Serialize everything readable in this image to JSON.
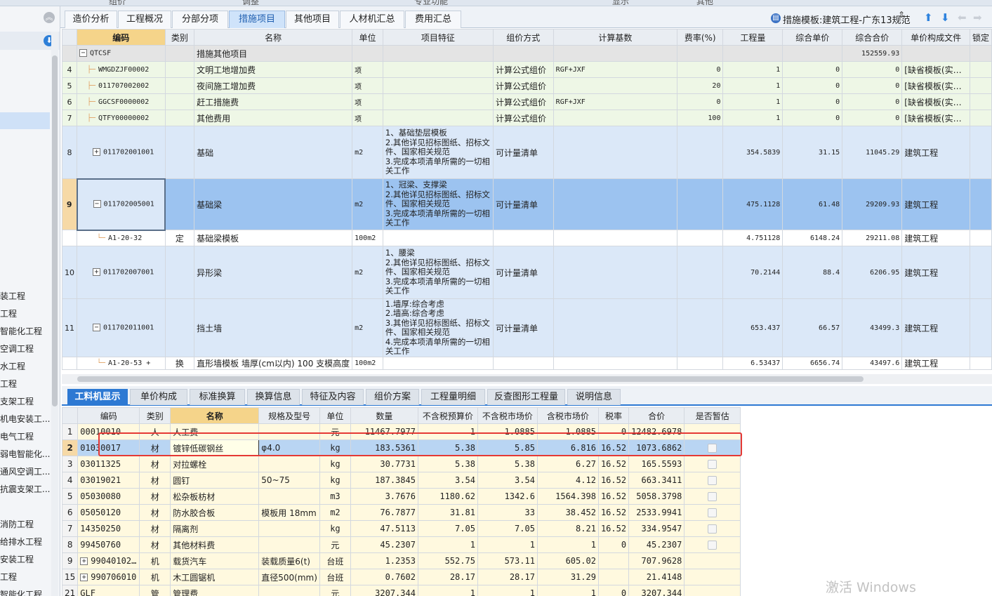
{
  "top_strip": [
    "组价",
    "调整",
    "专业功能",
    "显示",
    "其他"
  ],
  "sidebar": {
    "collapse_icon": "double-chevron-up-icon",
    "down_icon": "arrow-down-circle-icon",
    "items": [
      "装工程",
      "工程",
      "智能化工程",
      "空调工程",
      "水工程",
      "工程",
      "支架工程",
      "机电安装工...",
      "电气工程",
      "弱电智能化...",
      "通风空调工...",
      "抗震支架工...",
      "",
      "消防工程",
      "给排水工程",
      "安装工程",
      "工程",
      "智能化工程"
    ]
  },
  "tabs": [
    "造价分析",
    "工程概况",
    "分部分项",
    "措施项目",
    "其他项目",
    "人材机汇总",
    "费用汇总"
  ],
  "template": {
    "icon": "template-icon",
    "label": "措施模板:建筑工程-广东13规范",
    "spin": "⇕",
    "up": "⬆",
    "down": "⬇",
    "left": "⬅",
    "right": "➡"
  },
  "main_headers": [
    "编码",
    "类别",
    "名称",
    "单位",
    "项目特征",
    "组价方式",
    "计算基数",
    "费率(%)",
    "工程量",
    "综合单价",
    "综合合价",
    "单价构成文件",
    "锁定"
  ],
  "main_rows": [
    {
      "rn": "",
      "code": "QTCSF",
      "cat": "",
      "name": "措施其他项目",
      "unit": "",
      "feat": "",
      "method": "",
      "base": "",
      "rate": "",
      "qty": "",
      "price": "",
      "total": "152559.93",
      "file": ""
    },
    {
      "rn": "4",
      "code": "WMGDZJF00002",
      "cat": "",
      "name": "文明工地增加费",
      "unit": "项",
      "feat": "",
      "method": "计算公式组价",
      "base": "RGF+JXF",
      "rate": "0",
      "qty": "1",
      "price": "0",
      "total": "0",
      "file": "[缺省模板(实…"
    },
    {
      "rn": "5",
      "code": "011707002002",
      "cat": "",
      "name": "夜间施工增加费",
      "unit": "项",
      "feat": "",
      "method": "计算公式组价",
      "base": "",
      "rate": "20",
      "qty": "1",
      "price": "0",
      "total": "0",
      "file": "[缺省模板(实…"
    },
    {
      "rn": "6",
      "code": "GGCSF0000002",
      "cat": "",
      "name": "赶工措施费",
      "unit": "项",
      "feat": "",
      "method": "计算公式组价",
      "base": "RGF+JXF",
      "rate": "0",
      "qty": "1",
      "price": "0",
      "total": "0",
      "file": "[缺省模板(实…"
    },
    {
      "rn": "7",
      "code": "QTFY00000002",
      "cat": "",
      "name": "其他费用",
      "unit": "项",
      "feat": "",
      "method": "计算公式组价",
      "base": "",
      "rate": "100",
      "qty": "1",
      "price": "0",
      "total": "0",
      "file": "[缺省模板(实…"
    },
    {
      "rn": "8",
      "code": "011702001001",
      "cat": "",
      "name": "基础",
      "unit": "m2",
      "feat": "1、基础垫层模板\n2.其他详见招标图纸、招标文件、国家相关规范\n3.完成本项清单所需的一切相关工作",
      "method": "可计量清单",
      "base": "",
      "rate": "",
      "qty": "354.5839",
      "price": "31.15",
      "total": "11045.29",
      "file": "建筑工程"
    },
    {
      "rn": "9",
      "code": "011702005001",
      "cat": "",
      "name": "基础梁",
      "unit": "m2",
      "feat": "1、冠梁、支撑梁\n2.其他详见招标图纸、招标文件、国家相关规范\n3.完成本项清单所需的一切相关工作",
      "method": "可计量清单",
      "base": "",
      "rate": "",
      "qty": "475.1128",
      "price": "61.48",
      "total": "29209.93",
      "file": "建筑工程"
    },
    {
      "rn": "",
      "code": "A1-20-32",
      "cat": "定",
      "name": "基础梁模板",
      "unit": "100m2",
      "feat": "",
      "method": "",
      "base": "",
      "rate": "",
      "qty": "4.751128",
      "price": "6148.24",
      "total": "29211.08",
      "file": "建筑工程"
    },
    {
      "rn": "10",
      "code": "011702007001",
      "cat": "",
      "name": "异形梁",
      "unit": "m2",
      "feat": "1、腰梁\n2.其他详见招标图纸、招标文件、国家相关规范\n3.完成本项清单所需的一切相关工作",
      "method": "可计量清单",
      "base": "",
      "rate": "",
      "qty": "70.2144",
      "price": "88.4",
      "total": "6206.95",
      "file": "建筑工程"
    },
    {
      "rn": "11",
      "code": "011702011001",
      "cat": "",
      "name": "挡土墙",
      "unit": "m2",
      "feat": "1.墙厚:综合考虑\n2.墙高:综合考虑\n3.其他详见招标图纸、招标文件、国家相关规范\n4.完成本项清单所需的一切相关工作",
      "method": "可计量清单",
      "base": "",
      "rate": "",
      "qty": "653.437",
      "price": "66.57",
      "total": "43499.3",
      "file": "建筑工程"
    },
    {
      "rn": "",
      "code": "A1-20-53 +",
      "cat": "换",
      "name": "直形墙模板 墙厚(cm以内) 100 支模高度",
      "unit": "100m2",
      "feat": "",
      "method": "",
      "base": "",
      "rate": "",
      "qty": "6.53437",
      "price": "6656.74",
      "total": "43497.6",
      "file": "建筑工程"
    }
  ],
  "bottom_tabs": [
    "工料机显示",
    "单价构成",
    "标准换算",
    "换算信息",
    "特征及内容",
    "组价方案",
    "工程量明细",
    "反查图形工程量",
    "说明信息"
  ],
  "mat_headers": [
    "编码",
    "类别",
    "名称",
    "规格及型号",
    "单位",
    "数量",
    "不含税预算价",
    "不含税市场价",
    "含税市场价",
    "税率",
    "合价",
    "是否暂估"
  ],
  "mat_rows": [
    {
      "rn": "1",
      "code": "00010010",
      "cat": "人",
      "name": "人工费",
      "spec": "",
      "unit": "元",
      "qty": "11467.7977",
      "budget": "1",
      "market": "1.0885",
      "taxmarket": "1.0885",
      "tax": "0",
      "total": "12482.6978",
      "chk": false
    },
    {
      "rn": "2",
      "code": "01030017",
      "cat": "材",
      "name": "镀锌低碳钢丝",
      "spec": "φ4.0",
      "unit": "kg",
      "qty": "183.5361",
      "budget": "5.38",
      "market": "5.85",
      "taxmarket": "6.816",
      "tax": "16.52",
      "total": "1073.6862",
      "chk": true
    },
    {
      "rn": "3",
      "code": "03011325",
      "cat": "材",
      "name": "对拉螺栓",
      "spec": "",
      "unit": "kg",
      "qty": "30.7731",
      "budget": "5.38",
      "market": "5.38",
      "taxmarket": "6.27",
      "tax": "16.52",
      "total": "165.5593",
      "chk": true
    },
    {
      "rn": "4",
      "code": "03019021",
      "cat": "材",
      "name": "圆钉",
      "spec": "50~75",
      "unit": "kg",
      "qty": "187.3845",
      "budget": "3.54",
      "market": "3.54",
      "taxmarket": "4.12",
      "tax": "16.52",
      "total": "663.3411",
      "chk": true
    },
    {
      "rn": "5",
      "code": "05030080",
      "cat": "材",
      "name": "松杂板枋材",
      "spec": "",
      "unit": "m3",
      "qty": "3.7676",
      "budget": "1180.62",
      "market": "1342.6",
      "taxmarket": "1564.398",
      "tax": "16.52",
      "total": "5058.3798",
      "chk": true
    },
    {
      "rn": "6",
      "code": "05050120",
      "cat": "材",
      "name": "防水胶合板",
      "spec": "模板用 18mm",
      "unit": "m2",
      "qty": "76.7877",
      "budget": "31.81",
      "market": "33",
      "taxmarket": "38.452",
      "tax": "16.52",
      "total": "2533.9941",
      "chk": true
    },
    {
      "rn": "7",
      "code": "14350250",
      "cat": "材",
      "name": "隔离剂",
      "spec": "",
      "unit": "kg",
      "qty": "47.5113",
      "budget": "7.05",
      "market": "7.05",
      "taxmarket": "8.21",
      "tax": "16.52",
      "total": "334.9547",
      "chk": true
    },
    {
      "rn": "8",
      "code": "99450760",
      "cat": "材",
      "name": "其他材料费",
      "spec": "",
      "unit": "元",
      "qty": "45.2307",
      "budget": "1",
      "market": "1",
      "taxmarket": "1",
      "tax": "0",
      "total": "45.2307",
      "chk": true
    },
    {
      "rn": "9",
      "code": "99040102…",
      "cat": "机",
      "name": "载货汽车",
      "spec": "装载质量6(t)",
      "unit": "台班",
      "qty": "1.2353",
      "budget": "552.75",
      "market": "573.11",
      "taxmarket": "605.02",
      "tax": "",
      "total": "707.9628",
      "chk": false
    },
    {
      "rn": "15",
      "code": "990706010",
      "cat": "机",
      "name": "木工圆锯机",
      "spec": "直径500(mm)",
      "unit": "台班",
      "qty": "0.7602",
      "budget": "28.17",
      "market": "28.17",
      "taxmarket": "31.29",
      "tax": "",
      "total": "21.4148",
      "chk": false
    },
    {
      "rn": "21",
      "code": "GLF",
      "cat": "管",
      "name": "管理费",
      "spec": "",
      "unit": "元",
      "qty": "3207.344",
      "budget": "1",
      "market": "1",
      "taxmarket": "1",
      "tax": "0",
      "total": "3207.344",
      "chk": false
    }
  ],
  "watermark": "激活 Windows"
}
